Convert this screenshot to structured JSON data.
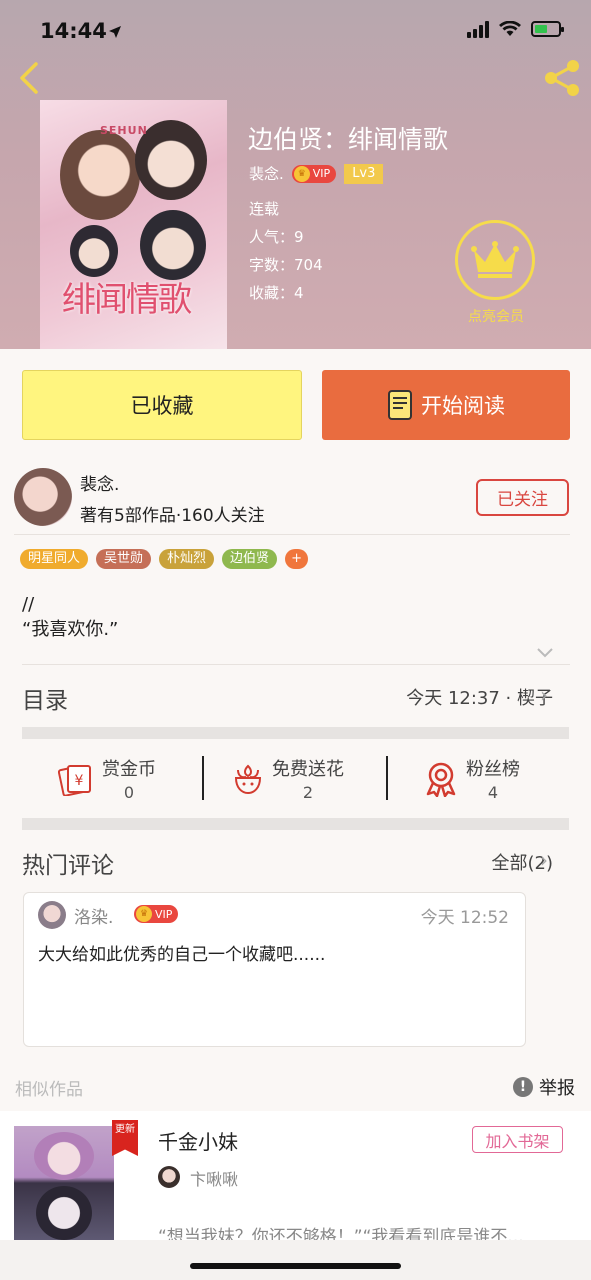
{
  "status_bar": {
    "time": "14:44"
  },
  "header": {
    "title": "边伯贤：绯闻情歌",
    "author": "裴念.",
    "vip_label": "VIP",
    "level": "Lv3",
    "status": "连载",
    "popularity": "人气：9",
    "word_count": "字数：704",
    "favorites": "收藏：4",
    "member_label": "点亮会员"
  },
  "cover": {
    "label": "SEHUN",
    "title": "绯闻情歌"
  },
  "actions": {
    "collect": "已收藏",
    "read": "开始阅读"
  },
  "author_info": {
    "name": "裴念.",
    "stats": "著有5部作品·160人关注",
    "follow": "已关注"
  },
  "tags": [
    {
      "label": "明星同人",
      "color": "#f0ab2d"
    },
    {
      "label": "吴世勋",
      "color": "#c56f57"
    },
    {
      "label": "朴灿烈",
      "color": "#c9a23a"
    },
    {
      "label": "边伯贤",
      "color": "#8fb84e"
    },
    {
      "label": "+",
      "color": "#f0763c"
    }
  ],
  "description": {
    "line1": "//",
    "line2": "“我喜欢你.”"
  },
  "toc": {
    "label": "目录",
    "info": "今天 12:37 · 楔子"
  },
  "stats": [
    {
      "label": "赏金币",
      "value": "0"
    },
    {
      "label": "免费送花",
      "value": "2"
    },
    {
      "label": "粉丝榜",
      "value": "4"
    }
  ],
  "hot_comments": {
    "label": "热门评论",
    "all": "全部(2)"
  },
  "comment": {
    "user": "洛染.",
    "vip": "VIP",
    "time": "今天 12:52",
    "text": "大大给如此优秀的自己一个收藏吧......"
  },
  "similar": {
    "label": "相似作品",
    "report": "举报"
  },
  "similar_item": {
    "badge": "更新",
    "title": "千金小妹",
    "add": "加入书架",
    "author": "卞啾啾",
    "quote": "“想当我妹？你还不够格！”“我看看到底是谁不..."
  }
}
